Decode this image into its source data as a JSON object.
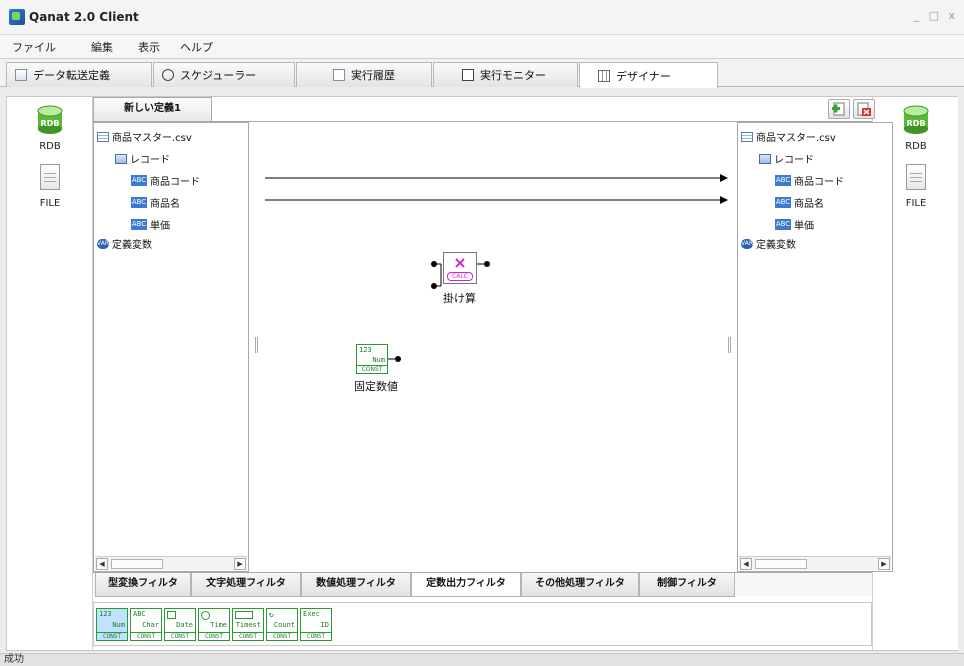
{
  "window": {
    "title": "Qanat 2.0 Client",
    "controls": "_ □ x"
  },
  "menu": [
    "ファイル",
    "編集",
    "表示",
    "ヘルプ"
  ],
  "tabs": [
    {
      "label": "データ転送定義",
      "icon": "transfer-icon"
    },
    {
      "label": "スケジューラー",
      "icon": "clock-icon"
    },
    {
      "label": "実行履歴",
      "icon": "history-icon"
    },
    {
      "label": "実行モニター",
      "icon": "monitor-icon"
    },
    {
      "label": "デザイナー",
      "icon": "designer-icon",
      "active": true
    }
  ],
  "left_sidebar": [
    {
      "label": "RDB",
      "icon": "database-icon"
    },
    {
      "label": "FILE",
      "icon": "file-icon"
    }
  ],
  "right_sidebar": [
    {
      "label": "RDB",
      "icon": "database-icon"
    },
    {
      "label": "FILE",
      "icon": "file-icon"
    }
  ],
  "definition_tab": "新しい定義1",
  "toolbar": {
    "add": "add-definition",
    "delete": "delete-definition"
  },
  "source_tree": {
    "file": "商品マスター.csv",
    "record": "レコード",
    "fields": [
      "商品コード",
      "商品名",
      "単価"
    ],
    "field_badge": "ABC",
    "variables": "定義変数",
    "var_badge": "VAR"
  },
  "target_tree": {
    "file": "商品マスター.csv",
    "record": "レコード",
    "fields": [
      "商品コード",
      "商品名",
      "単価"
    ],
    "field_badge": "ABC",
    "variables": "定義変数",
    "var_badge": "VAR"
  },
  "canvas": {
    "calc_node": {
      "label": "掛け算",
      "badge": "CALC",
      "symbol": "×"
    },
    "const_node": {
      "label": "固定数値",
      "line1": "123",
      "line2": "Num",
      "line3": "CONST"
    }
  },
  "filter_tabs": [
    {
      "label": "型変換フィルタ"
    },
    {
      "label": "文字処理フィルタ"
    },
    {
      "label": "数値処理フィルタ"
    },
    {
      "label": "定数出力フィルタ",
      "active": true
    },
    {
      "label": "その他処理フィルタ"
    },
    {
      "label": "制御フィルタ"
    }
  ],
  "palette": [
    {
      "top": "123",
      "mid": "Num",
      "bottom": "CONST",
      "selected": true
    },
    {
      "top": "ABC",
      "mid": "Char",
      "bottom": "CONST"
    },
    {
      "top": "",
      "mid": "Date",
      "bottom": "CONST"
    },
    {
      "top": "",
      "mid": "Time",
      "bottom": "CONST"
    },
    {
      "top": "",
      "mid": "Timest",
      "bottom": "CONST"
    },
    {
      "top": "",
      "mid": "Count",
      "bottom": "CONST"
    },
    {
      "top": "Exec",
      "mid": "ID",
      "bottom": "CONST"
    }
  ],
  "status": "成功"
}
